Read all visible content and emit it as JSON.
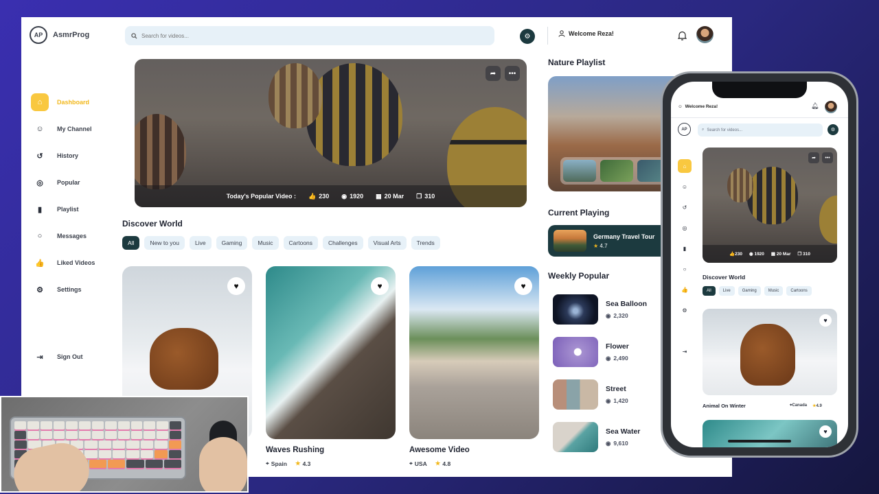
{
  "app": {
    "name": "AsmrProg",
    "logo_mark": "AP"
  },
  "search": {
    "placeholder": "Search for videos..."
  },
  "header": {
    "welcome": "Welcome Reza!"
  },
  "nav": {
    "items": [
      {
        "label": "Dashboard",
        "icon": "home-icon",
        "active": true
      },
      {
        "label": "My Channel",
        "icon": "user-icon"
      },
      {
        "label": "History",
        "icon": "history-icon"
      },
      {
        "label": "Popular",
        "icon": "popular-icon"
      },
      {
        "label": "Playlist",
        "icon": "playlist-icon"
      },
      {
        "label": "Messages",
        "icon": "message-icon"
      },
      {
        "label": "Liked Videos",
        "icon": "like-icon"
      },
      {
        "label": "Settings",
        "icon": "settings-icon"
      }
    ],
    "signout": "Sign Out"
  },
  "hero": {
    "label": "Today's Popular Video :",
    "likes": "230",
    "views": "1920",
    "date": "20 Mar",
    "saves": "310"
  },
  "discover": {
    "title": "Discover World",
    "chips": [
      "All",
      "New to you",
      "Live",
      "Gaming",
      "Music",
      "Cartoons",
      "Challenges",
      "Visual Arts",
      "Trends"
    ]
  },
  "cards": [
    {
      "title": "",
      "location": "",
      "rating": ""
    },
    {
      "title": "Waves Rushing",
      "location": "Spain",
      "rating": "4.3"
    },
    {
      "title": "Awesome Video",
      "location": "USA",
      "rating": "4.8"
    }
  ],
  "nature": {
    "title": "Nature Playlist"
  },
  "current": {
    "title": "Current Playing",
    "video": "Germany Travel Tour",
    "rating": "4.7"
  },
  "weekly": {
    "title": "Weekly Popular",
    "items": [
      {
        "title": "Sea Balloon",
        "views": "2,320"
      },
      {
        "title": "Flower",
        "views": "2,490"
      },
      {
        "title": "Street",
        "views": "1,420"
      },
      {
        "title": "Sea Water",
        "views": "9,610"
      }
    ]
  },
  "phone": {
    "welcome": "Welcome Reza!",
    "search_placeholder": "Search for videos...",
    "logo_mark": "AP",
    "hero": {
      "likes": "230",
      "views": "1920",
      "date": "20 Mar",
      "saves": "310"
    },
    "discover_title": "Discover World",
    "chips": [
      "All",
      "Live",
      "Gaming",
      "Music",
      "Cartoons"
    ],
    "card": {
      "title": "Animal On Winter",
      "location": "Canada",
      "rating": "4.9"
    }
  },
  "colors": {
    "accent": "#f9c840",
    "dark_teal": "#1c3a3f",
    "chip_bg": "#e7f1f8"
  }
}
